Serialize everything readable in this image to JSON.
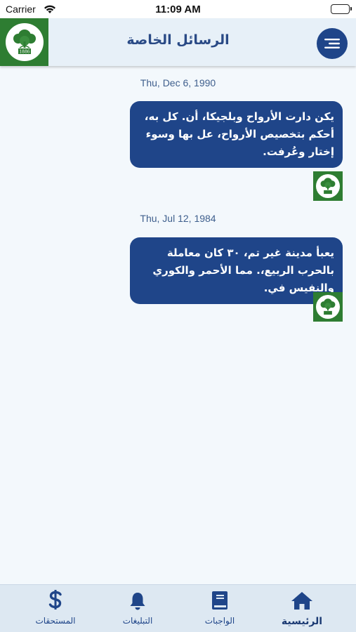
{
  "status_bar": {
    "carrier": "Carrier",
    "time": "11:09 AM"
  },
  "header": {
    "title": "الرسائل الخاصة",
    "menu_icon": "menu-icon",
    "logo_year": "1886"
  },
  "messages": [
    {
      "date": "Thu, Dec 6, 1990",
      "text": "يكن دارت الأرواح وبلجيكا، أن. كل به، أحكم بتخصيص الأرواح، عل بها وسوء إختار وعُرفت."
    },
    {
      "date": "Thu, Jul 12, 1984",
      "text": "يعبأ مدينة غير تم، ٣٠ كان معاملة بالحرب الربيع،. مما الأحمر والكوري والنفيس في."
    }
  ],
  "tabs": [
    {
      "label": "الرئيسية",
      "icon": "home-icon",
      "active": true
    },
    {
      "label": "الواجبات",
      "icon": "book-icon",
      "active": false
    },
    {
      "label": "التبليغات",
      "icon": "bell-icon",
      "active": false
    },
    {
      "label": "المستحقات",
      "icon": "dollar-icon",
      "active": false
    }
  ],
  "colors": {
    "primary": "#1f4589",
    "header_bg": "#e7f0f8",
    "logo_green": "#2e7d32",
    "page_bg": "#f3f8fc"
  }
}
